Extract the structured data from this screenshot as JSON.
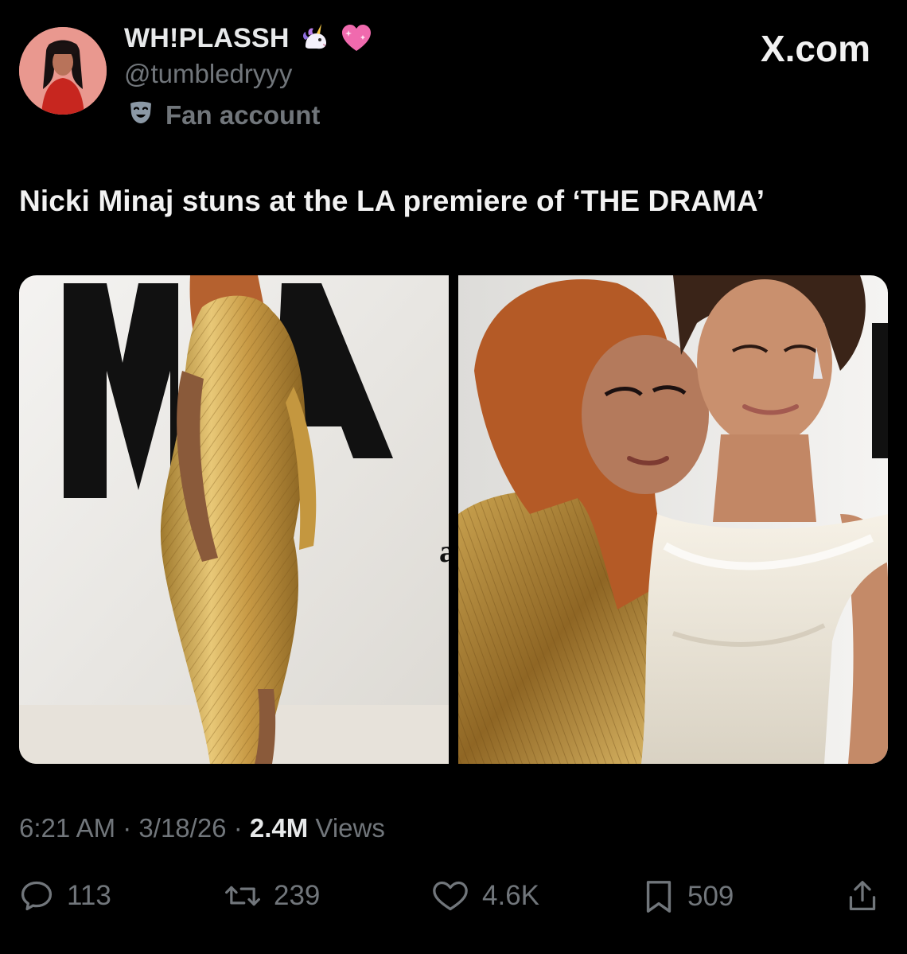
{
  "header": {
    "display_name": "WH!PLASSH",
    "name_emojis": [
      "unicorn-icon",
      "sparkling-heart-icon"
    ],
    "handle": "@tumbledryyy",
    "account_label": "Fan account",
    "account_icon": "theater-masks-icon",
    "site": "X.com"
  },
  "tweet": {
    "text": "Nicki Minaj stuns at the LA premiere of ‘THE DRAMA’"
  },
  "media": {
    "photos": [
      {
        "name": "photo-gold-dress"
      },
      {
        "name": "photo-selfie"
      }
    ]
  },
  "meta": {
    "time": "6:21 AM",
    "date": "3/18/26",
    "views_count": "2.4M",
    "views_label": "Views",
    "separator": "·"
  },
  "actions": {
    "replies": "113",
    "reposts": "239",
    "likes": "4.6K",
    "bookmarks": "509"
  },
  "colors": {
    "background": "#000000",
    "primary_text": "#e7e9ea",
    "secondary_text": "#71767b"
  }
}
